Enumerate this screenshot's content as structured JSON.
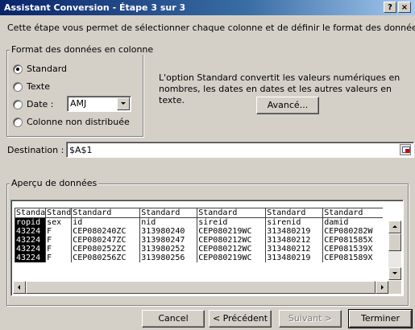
{
  "window": {
    "title": "Assistant Conversion - Étape 3 sur 3",
    "help_label": "?",
    "close_label": "×"
  },
  "intro_text": "Cette étape vous permet de sélectionner chaque colonne et de définir le format des données.",
  "column_format": {
    "group_label": "Format des données en colonne",
    "options": [
      {
        "label": "Standard",
        "selected": true
      },
      {
        "label": "Texte",
        "selected": false
      },
      {
        "label": "Date :",
        "selected": false
      },
      {
        "label": "Colonne non distribuée",
        "selected": false
      }
    ],
    "date_format_value": "AMJ"
  },
  "description_text": "L'option Standard convertit les valeurs numériques en nombres, les dates en dates et les autres valeurs en texte.",
  "advanced_button": "Avancé...",
  "destination": {
    "label": "Destination :",
    "value": "$A$1"
  },
  "preview": {
    "group_label": "Aperçu de données",
    "headers": [
      "Standa",
      "Stand",
      "Standard",
      "Standard",
      "Standard",
      "Standard",
      "Standard"
    ],
    "rows": [
      [
        "ropid",
        "sex",
        "id",
        "nid",
        "sireid",
        "sirenid",
        "damid"
      ],
      [
        "43224",
        "F",
        "CEP080240ZC",
        "313980240",
        "CEP080219WC",
        "313480219",
        "CEP080282W"
      ],
      [
        "43224",
        "F",
        "CEP080247ZC",
        "313980247",
        "CEP080212WC",
        "313480212",
        "CEP081585X"
      ],
      [
        "43224",
        "F",
        "CEP080252ZC",
        "313980252",
        "CEP080212WC",
        "313480212",
        "CEP081539X"
      ],
      [
        "43224",
        "F",
        "CEP080256ZC",
        "313980256",
        "CEP080219WC",
        "313480219",
        "CEP081589X"
      ]
    ]
  },
  "buttons": {
    "cancel": "Cancel",
    "previous": "< Précédent",
    "next": "Suivant >",
    "finish": "Terminer"
  }
}
